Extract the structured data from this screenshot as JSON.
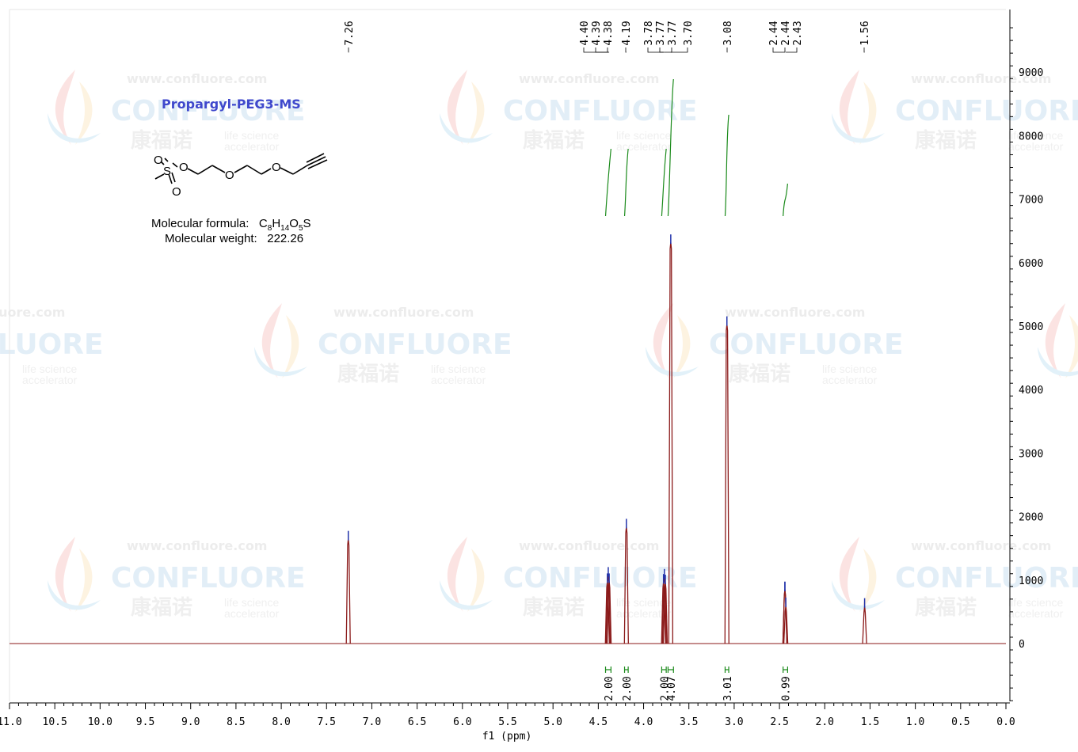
{
  "compound": {
    "name": "Propargyl-PEG3-MS",
    "formula_label": "Molecular formula:",
    "formula_c": "C",
    "formula_c_n": "8",
    "formula_h": "H",
    "formula_h_n": "14",
    "formula_o": "O",
    "formula_o_n": "5",
    "formula_s": "S",
    "weight_label": "Molecular weight:",
    "weight_value": "222.26",
    "structure_atoms": [
      "S",
      "O",
      "O",
      "O",
      "O",
      "O"
    ]
  },
  "watermark": {
    "url": "www.confluore.com",
    "brand": "CONFLUORE",
    "brand_cn": "康福诺",
    "tagline_1": "life science",
    "tagline_2": "accelerator"
  },
  "colors": {
    "spectrum": "#8b1a1a",
    "integral": "#1a8a1a",
    "peak_marker": "#2233aa",
    "title": "#3f48cc"
  },
  "chart_data": {
    "type": "line",
    "xlabel": "f1 (ppm)",
    "ylabel": "",
    "xlim": [
      11.0,
      0.0
    ],
    "ylim": [
      -900,
      10000
    ],
    "x_ticks": [
      "11.0",
      "10.5",
      "10.0",
      "9.5",
      "9.0",
      "8.5",
      "8.0",
      "7.5",
      "7.0",
      "6.5",
      "6.0",
      "5.5",
      "5.0",
      "4.5",
      "4.0",
      "3.5",
      "3.0",
      "2.5",
      "2.0",
      "1.5",
      "1.0",
      "0.5",
      "0.0"
    ],
    "y_ticks": [
      "0",
      "1000",
      "2000",
      "3000",
      "4000",
      "5000",
      "6000",
      "7000",
      "8000",
      "9000"
    ],
    "peaks": [
      {
        "ppm": 7.26,
        "height": 1650
      },
      {
        "ppm": 4.4,
        "height": 980
      },
      {
        "ppm": 4.39,
        "height": 1080
      },
      {
        "ppm": 4.38,
        "height": 980
      },
      {
        "ppm": 4.19,
        "height": 1840
      },
      {
        "ppm": 3.78,
        "height": 970
      },
      {
        "ppm": 3.77,
        "height": 1050
      },
      {
        "ppm": 3.76,
        "height": 960
      },
      {
        "ppm": 3.7,
        "height": 6320
      },
      {
        "ppm": 3.08,
        "height": 5030
      },
      {
        "ppm": 2.44,
        "height": 850
      },
      {
        "ppm": 2.44,
        "height": 850
      },
      {
        "ppm": 2.43,
        "height": 600
      },
      {
        "ppm": 1.56,
        "height": 590
      }
    ],
    "peak_labels": [
      {
        "ppm": 7.26,
        "text": "7.26"
      },
      {
        "ppm": 4.4,
        "text": "4.40"
      },
      {
        "ppm": 4.39,
        "text": "4.39"
      },
      {
        "ppm": 4.38,
        "text": "4.38"
      },
      {
        "ppm": 4.19,
        "text": "4.19"
      },
      {
        "ppm": 3.78,
        "text": "3.78"
      },
      {
        "ppm": 3.77,
        "text": "3.77"
      },
      {
        "ppm": 3.77,
        "text": "3.77"
      },
      {
        "ppm": 3.7,
        "text": "3.70"
      },
      {
        "ppm": 3.08,
        "text": "3.08"
      },
      {
        "ppm": 2.44,
        "text": "2.44"
      },
      {
        "ppm": 2.44,
        "text": "2.44"
      },
      {
        "ppm": 2.43,
        "text": "2.43"
      },
      {
        "ppm": 1.56,
        "text": "1.56"
      }
    ],
    "integrals": [
      {
        "from": 4.42,
        "to": 4.36,
        "value": "2.00"
      },
      {
        "from": 4.21,
        "to": 4.17,
        "value": "2.00"
      },
      {
        "from": 3.8,
        "to": 3.75,
        "value": "2.00"
      },
      {
        "from": 3.73,
        "to": 3.67,
        "value": "4.07"
      },
      {
        "from": 3.1,
        "to": 3.06,
        "value": "3.01"
      },
      {
        "from": 2.46,
        "to": 2.41,
        "value": "0.99"
      }
    ]
  }
}
